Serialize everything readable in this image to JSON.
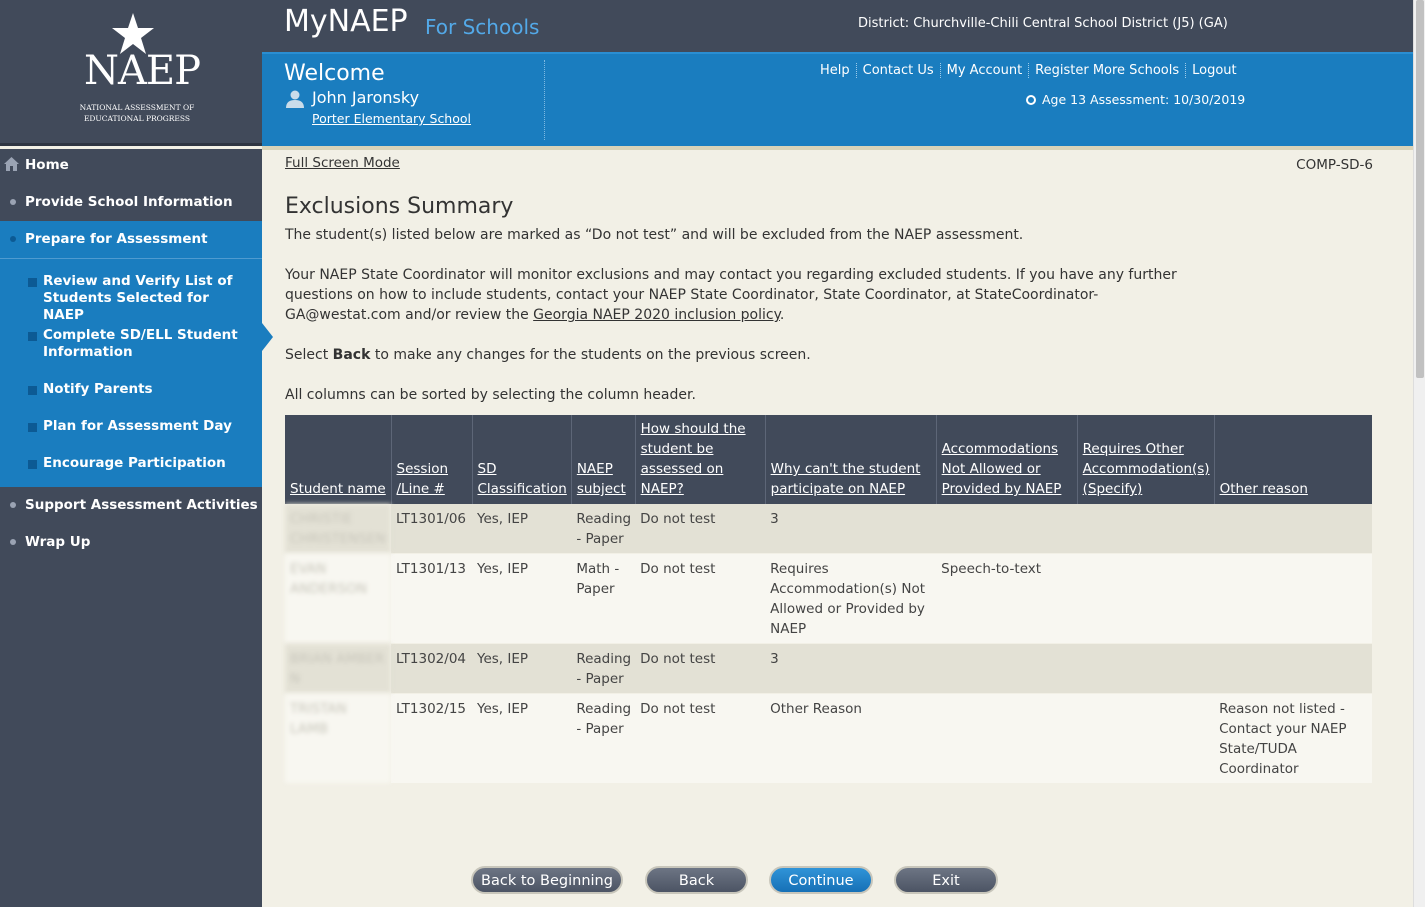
{
  "header": {
    "logo_text": "NAEP",
    "logo_subtitle": "NATIONAL ASSESSMENT OF EDUCATIONAL PROGRESS",
    "app_title": "MyNAEP",
    "app_title_sub": "For Schools",
    "district": "District: Churchville-Chili Central School District (J5) (GA)"
  },
  "welcome": {
    "title": "Welcome",
    "user_name": "John Jaronsky",
    "school": "Porter Elementary School",
    "links": [
      "Help",
      "Contact Us",
      "My Account",
      "Register More Schools",
      "Logout"
    ],
    "assessment": "Age 13 Assessment: 10/30/2019"
  },
  "sidebar": {
    "home": "Home",
    "provide": "Provide School Information",
    "prepare": "Prepare for Assessment",
    "sub_items": [
      "Review and Verify List of Students Selected for NAEP",
      "Complete SD/ELL Student Information",
      "Notify Parents",
      "Plan for Assessment Day",
      "Encourage Participation"
    ],
    "support": "Support Assessment Activities",
    "wrap": "Wrap Up"
  },
  "main": {
    "full_screen": "Full Screen Mode",
    "page_code": "COMP-SD-6",
    "title": "Exclusions Summary",
    "intro": "The student(s) listed below are marked as “Do not test” and will be excluded from the NAEP assessment.",
    "monitor_text": "Your NAEP State Coordinator will monitor exclusions and may contact you regarding excluded students. If you have any further questions on how to include students, contact your NAEP State Coordinator, State Coordinator, at StateCoordinator-GA@westat.com and/or review the",
    "policy_link": "Georgia NAEP 2020 inclusion policy",
    "select_prefix": "Select",
    "select_bold": "Back",
    "select_suffix": "to make any changes for the students on the previous screen.",
    "sort_note": "All columns can be sorted by selecting the column header."
  },
  "table": {
    "headers": [
      "Student name",
      "Session /Line #",
      "SD Classification",
      "NAEP subject",
      "How should the student be assessed on NAEP?",
      "Why can't the student participate on NAEP",
      "Accommodations Not Allowed or Provided by NAEP",
      "Requires Other Accommodation(s) (Specify)",
      "Other reason"
    ],
    "rows": [
      [
        "CHRISTIE CHRISTENSEN",
        "LT1301/06",
        "Yes, IEP",
        "Reading - Paper",
        "Do not test",
        "3",
        "",
        "",
        ""
      ],
      [
        "EVAN ANDERSON",
        "LT1301/13",
        "Yes, IEP",
        "Math - Paper",
        "Do not test",
        "Requires Accommodation(s) Not Allowed or Provided by NAEP",
        "Speech-to-text",
        "",
        ""
      ],
      [
        "BRIAN AMBER N",
        "LT1302/04",
        "Yes, IEP",
        "Reading - Paper",
        "Do not test",
        "3",
        "",
        "",
        ""
      ],
      [
        "TRISTAN LAMB",
        "LT1302/15",
        "Yes, IEP",
        "Reading - Paper",
        "Do not test",
        "Other Reason",
        "",
        "",
        "Reason not listed - Contact your NAEP State/TUDA Coordinator"
      ]
    ]
  },
  "buttons": {
    "back_to_beginning": "Back to Beginning",
    "back": "Back",
    "continue": "Continue",
    "exit": "Exit"
  },
  "colors": {
    "header_dark": "#414a5a",
    "accent_blue": "#1a7dbf",
    "page_bg": "#f2f0e6"
  }
}
